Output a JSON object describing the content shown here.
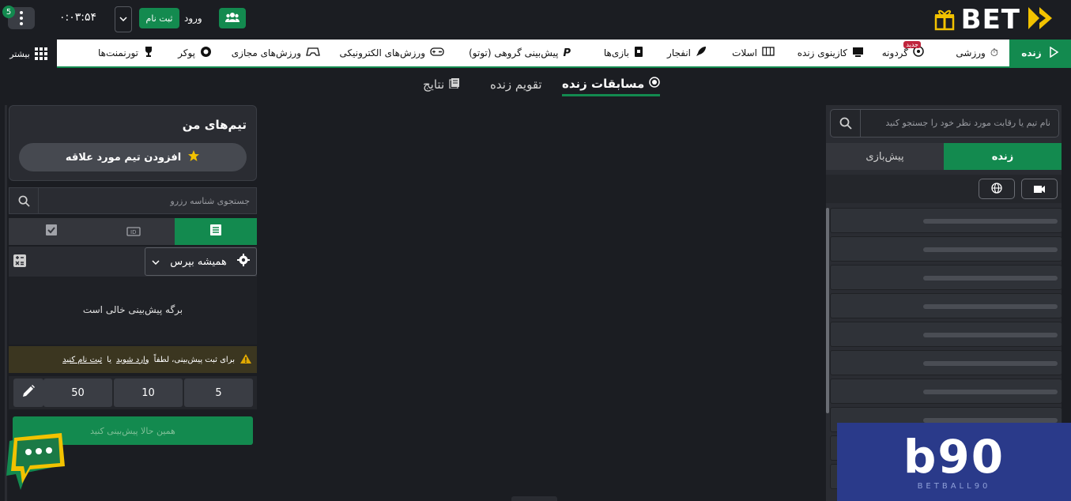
{
  "topbar": {
    "logo_text": "BET",
    "notification_count": "5",
    "clock": "۰:۰۳:۵۴",
    "signup_label": "ثبت نام",
    "login_label": "ورود"
  },
  "nav": {
    "live_label": "زنده",
    "items": [
      {
        "label": "ورزشی"
      },
      {
        "label": "گردونه",
        "tag": "جدید"
      },
      {
        "label": "کازینوی زنده"
      },
      {
        "label": "اسلات"
      },
      {
        "label": "انفجار"
      },
      {
        "label": "بازی‌ها"
      },
      {
        "label": "پیش‌بینی گروهی (توتو)"
      },
      {
        "label": "ورزش‌های الکترونیکی"
      },
      {
        "label": "ورزش‌های مجازی"
      },
      {
        "label": "پوکر"
      },
      {
        "label": "تورنمنت‌ها"
      }
    ],
    "more_label": "بیشتر"
  },
  "subtabs": {
    "live": "مسابقات زنده",
    "calendar": "تقویم زنده",
    "results": "نتایج"
  },
  "right_sidebar": {
    "search_placeholder": "نام تیم یا رقابت مورد نظر خود را جستجو کنید",
    "tab_live": "زنده",
    "tab_prematch": "پیش‌بازی"
  },
  "left_panel": {
    "my_teams_title": "تیم‌های من",
    "add_fav_label": "افزودن تیم مورد علاقه",
    "bet_search_placeholder": "جستجوی شناسه رزرو",
    "odds_option": "همیشه بپرس",
    "empty_slip": "برگه پیش‌بینی خالی است",
    "warning": {
      "prefix": "برای ثبت پیش‌بینی، لطفاً",
      "login_link": "وارد شوید",
      "or": "یا",
      "signup_link": "ثبت نام کنید"
    },
    "stakes": [
      "5",
      "10",
      "50"
    ],
    "place_bet_label": "همین حالا پیش‌بینی کنید"
  },
  "watermark": {
    "logo": "b90",
    "text": "BETBALL90"
  },
  "colors": {
    "accent": "#138a4f",
    "background": "#1b1d22",
    "panel": "#2a2c32"
  }
}
